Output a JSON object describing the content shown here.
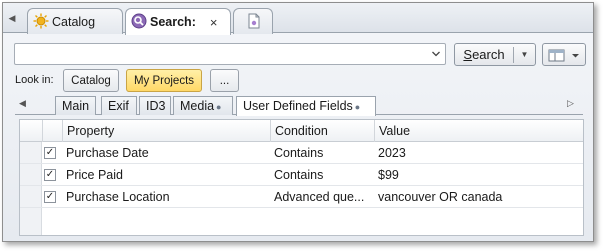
{
  "doc_tabs": {
    "tabs": [
      {
        "label": "Catalog",
        "icon": "sun-catalog-icon"
      },
      {
        "label": "Search:",
        "icon": "search-orb-icon",
        "close": "×"
      },
      {
        "label": "",
        "icon": "new-document-icon"
      }
    ],
    "nav_arrow": "◀"
  },
  "search": {
    "query": "",
    "button_label": "Search",
    "dropdown_glyph": "▼"
  },
  "look_in": {
    "label": "Look in:",
    "options": [
      {
        "label": "Catalog",
        "selected": false
      },
      {
        "label": "My Projects",
        "selected": true
      },
      {
        "label": "...",
        "selected": false
      }
    ]
  },
  "sub_tabs": {
    "left_arrow": "◀",
    "right_arrow": "▷",
    "tabs": [
      {
        "label": "Main"
      },
      {
        "label": "Exif"
      },
      {
        "label": "ID3"
      },
      {
        "label": "Media",
        "dot": "●"
      },
      {
        "label": "User Defined Fields",
        "dot": "●",
        "active": true
      }
    ]
  },
  "grid": {
    "columns": [
      "Property",
      "Condition",
      "Value"
    ],
    "rows": [
      {
        "checked": "✓",
        "property": "Purchase Date",
        "condition": "Contains",
        "value": "2023"
      },
      {
        "checked": "✓",
        "property": "Price Paid",
        "condition": "Contains",
        "value": "$99"
      },
      {
        "checked": "✓",
        "property": "Purchase Location",
        "condition": "Advanced que...",
        "value": "vancouver OR canada"
      }
    ]
  },
  "colors": {
    "selected_button": "#ffd867",
    "border": "#9aa3ad"
  }
}
